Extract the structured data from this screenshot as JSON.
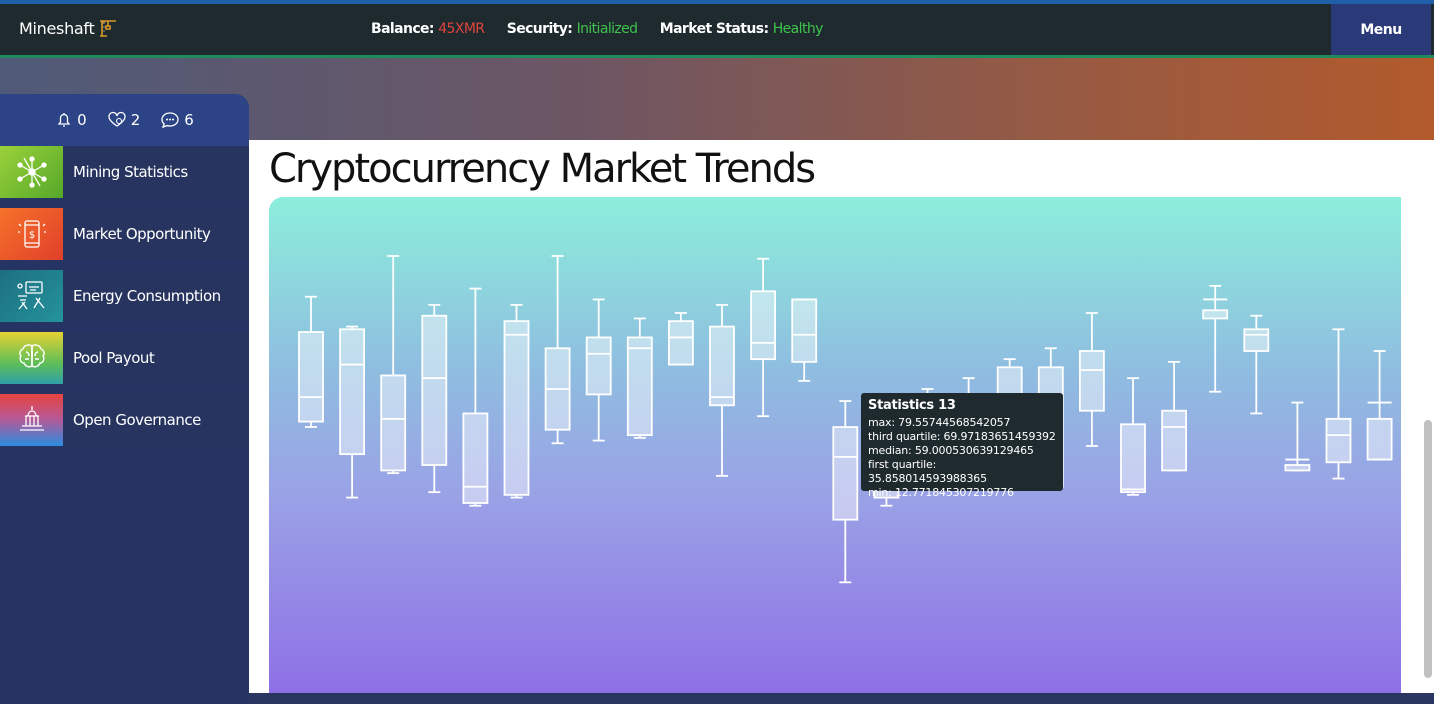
{
  "app": {
    "title": "Mineshaft"
  },
  "header": {
    "balance_label": "Balance:",
    "balance_value": "45XMR",
    "security_label": "Security:",
    "security_value": "Initialized",
    "market_label": "Market Status:",
    "market_value": "Healthy",
    "menu_label": "Menu"
  },
  "counters": [
    {
      "icon": "bell-icon",
      "count": "0"
    },
    {
      "icon": "heart-hand-icon",
      "count": "2"
    },
    {
      "icon": "chat-icon",
      "count": "6"
    }
  ],
  "sidebar": {
    "items": [
      {
        "label": "Mining Statistics",
        "icon": "network-icon",
        "color": "#7fc12b"
      },
      {
        "label": "Market Opportunity",
        "icon": "phone-dollar-icon",
        "color": "#f05a28"
      },
      {
        "label": "Energy Consumption",
        "icon": "circuit-tools-icon",
        "color": "#1e7d8c"
      },
      {
        "label": "Pool Payout",
        "icon": "brain-icon",
        "color": "#e8d030"
      },
      {
        "label": "Open Governance",
        "icon": "capitol-icon",
        "color": "#e04a45"
      }
    ]
  },
  "main": {
    "title": "Cryptocurrency Market Trends"
  },
  "tooltip": {
    "title": "Statistics 13",
    "max": "max: 79.55744568542057",
    "q3": "third quartile: 69.97183651459392",
    "median": "median: 59.000530639129465",
    "q1": "first quartile: 35.858014593988365",
    "min": "min: 12.771845307219776"
  },
  "chart_data": {
    "type": "box",
    "ylim": [
      0,
      100
    ],
    "boxes": [
      {
        "min": 70,
        "q1": 72,
        "median": 81,
        "q3": 105,
        "max": 118
      },
      {
        "min": 44,
        "q1": 60,
        "median": 93,
        "q3": 106,
        "max": 107
      },
      {
        "min": 53,
        "q1": 54,
        "median": 73,
        "q3": 89,
        "max": 133
      },
      {
        "min": 46,
        "q1": 56,
        "median": 88,
        "q3": 111,
        "max": 115
      },
      {
        "min": 41,
        "q1": 42,
        "median": 48,
        "q3": 75,
        "max": 121
      },
      {
        "min": 44,
        "q1": 45,
        "median": 104,
        "q3": 109,
        "max": 115
      },
      {
        "min": 64,
        "q1": 69,
        "median": 84,
        "q3": 99,
        "max": 133
      },
      {
        "min": 65,
        "q1": 82,
        "median": 97,
        "q3": 103,
        "max": 117
      },
      {
        "min": 66,
        "q1": 67,
        "median": 99,
        "q3": 103,
        "max": 110
      },
      {
        "min": 100,
        "q1": 93,
        "median": 103,
        "q3": 109,
        "max": 112
      },
      {
        "min": 52,
        "q1": 78,
        "median": 81,
        "q3": 107,
        "max": 115
      },
      {
        "min": 74,
        "q1": 95,
        "median": 101,
        "q3": 120,
        "max": 132
      },
      {
        "min": 87,
        "q1": 94,
        "median": 104,
        "q3": 117,
        "max": 110
      },
      {
        "min": 12.771845307219776,
        "q1": 35.858014593988365,
        "median": 59.000530639129465,
        "q3": 69.97183651459392,
        "max": 79.55744568542057
      },
      {
        "min": 41,
        "q1": 44,
        "median": 47,
        "q3": 60,
        "max": 80
      },
      {
        "min": 57,
        "q1": 61,
        "median": 63,
        "q3": 80,
        "max": 84
      },
      {
        "min": 59,
        "q1": 61,
        "median": 67,
        "q3": 76,
        "max": 88
      },
      {
        "min": 61,
        "q1": 70,
        "median": 71,
        "q3": 92,
        "max": 95
      },
      {
        "min": 56,
        "q1": 48,
        "median": 55,
        "q3": 92,
        "max": 99
      },
      {
        "min": 63,
        "q1": 76,
        "median": 91,
        "q3": 98,
        "max": 112
      },
      {
        "min": 45,
        "q1": 46,
        "median": 47,
        "q3": 71,
        "max": 88
      },
      {
        "min": 58,
        "q1": 54,
        "median": 70,
        "q3": 76,
        "max": 94
      },
      {
        "min": 83,
        "q1": 110,
        "median": 117,
        "q3": 113,
        "max": 122
      },
      {
        "min": 75,
        "q1": 98,
        "median": 104,
        "q3": 106,
        "max": 111
      },
      {
        "min": 54,
        "q1": 56,
        "median": 58,
        "q3": 54,
        "max": 79
      },
      {
        "min": 51,
        "q1": 57,
        "median": 67,
        "q3": 73,
        "max": 106
      },
      {
        "min": 74,
        "q1": 58,
        "median": 79,
        "q3": 73,
        "max": 98
      },
      {
        "min": 64,
        "q1": 55,
        "median": 74,
        "q3": 87,
        "max": 117
      }
    ]
  }
}
